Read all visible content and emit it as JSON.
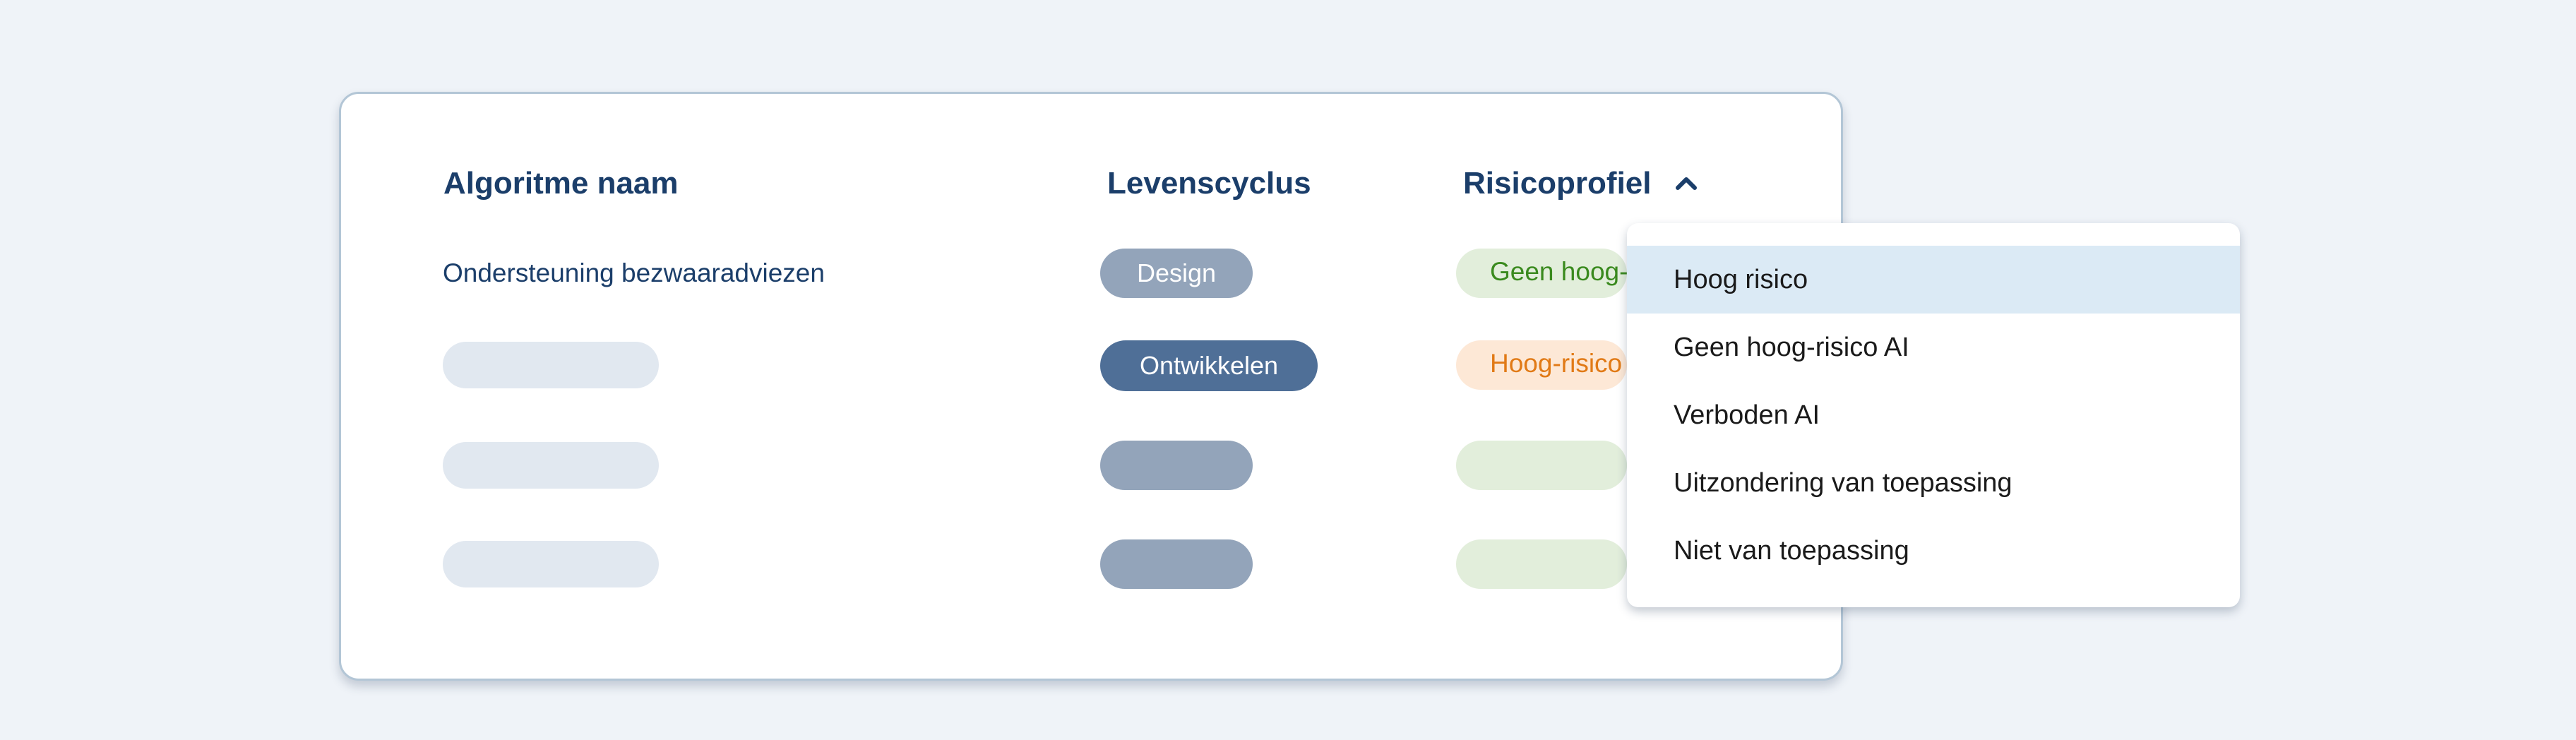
{
  "columns": {
    "name": "Algoritme naam",
    "lifecycle": "Levenscyclus",
    "risk": "Risicoprofiel"
  },
  "rows": [
    {
      "name": "Ondersteuning bezwaaradviezen",
      "lifecycle": "Design",
      "risk": "Geen hoog-risico AI"
    },
    {
      "name": "",
      "lifecycle": "Ontwikkelen",
      "risk": "Hoog-risico AI"
    },
    {
      "name": "",
      "lifecycle": "",
      "risk": ""
    },
    {
      "name": "",
      "lifecycle": "",
      "risk": ""
    }
  ],
  "dropdown": {
    "icon": "chevron-up-icon",
    "selected_index": 0,
    "options": [
      "Hoog risico",
      "Geen hoog-risico AI",
      "Verboden AI",
      "Uitzondering van toepassing",
      "Niet van toepassing"
    ]
  },
  "colors": {
    "header_text": "#1b3e6a",
    "pill_design": "#93a4ba",
    "pill_ontwikkelen": "#4f6f97",
    "pill_placeholder": "#93a4ba",
    "placeholder_light": "#e1e8f0",
    "risk_green_bg": "#e2eedb",
    "risk_green_text": "#3a8a1e",
    "risk_orange_bg": "#fde8d6",
    "risk_orange_text": "#e17a16",
    "option_selected_bg": "#dbeaf5"
  }
}
